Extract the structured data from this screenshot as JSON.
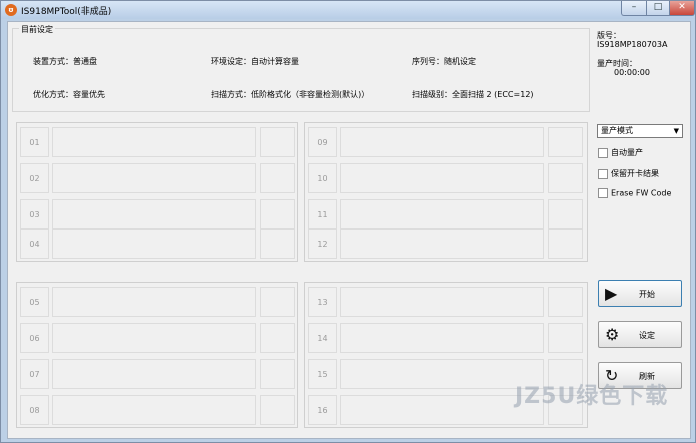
{
  "window": {
    "title": "IS918MPTool(非成品)",
    "icon": "app-icon",
    "buttons": {
      "minimize": "–",
      "maximize": "□",
      "close": "✕"
    }
  },
  "settings": {
    "group_title": "目前设定",
    "items": [
      "装置方式：普通盘",
      "环境设定：自动计算容量",
      "序列号：随机设定",
      "优化方式：容量优先",
      "扫描方式：低阶格式化（非容量检测(默认)）",
      "扫描级别：全面扫描 2 (ECC=12)"
    ]
  },
  "version": {
    "label": "版号：",
    "value": "IS918MP180703A"
  },
  "time": {
    "label": "量产时间：",
    "value": "00:00:00"
  },
  "slots": {
    "top_left": [
      "01",
      "02",
      "03",
      "04"
    ],
    "top_right": [
      "09",
      "10",
      "11",
      "12"
    ],
    "bottom_left": [
      "05",
      "06",
      "07",
      "08"
    ],
    "bottom_right": [
      "13",
      "14",
      "15",
      "16"
    ]
  },
  "mode_select": {
    "value": "量产模式"
  },
  "checkboxes": [
    "自动量产",
    "保留开卡结果",
    "Erase FW Code"
  ],
  "actions": {
    "start": "开始",
    "settings": "设定",
    "refresh": "刷新"
  },
  "watermark": "JZ5U绿色下载"
}
